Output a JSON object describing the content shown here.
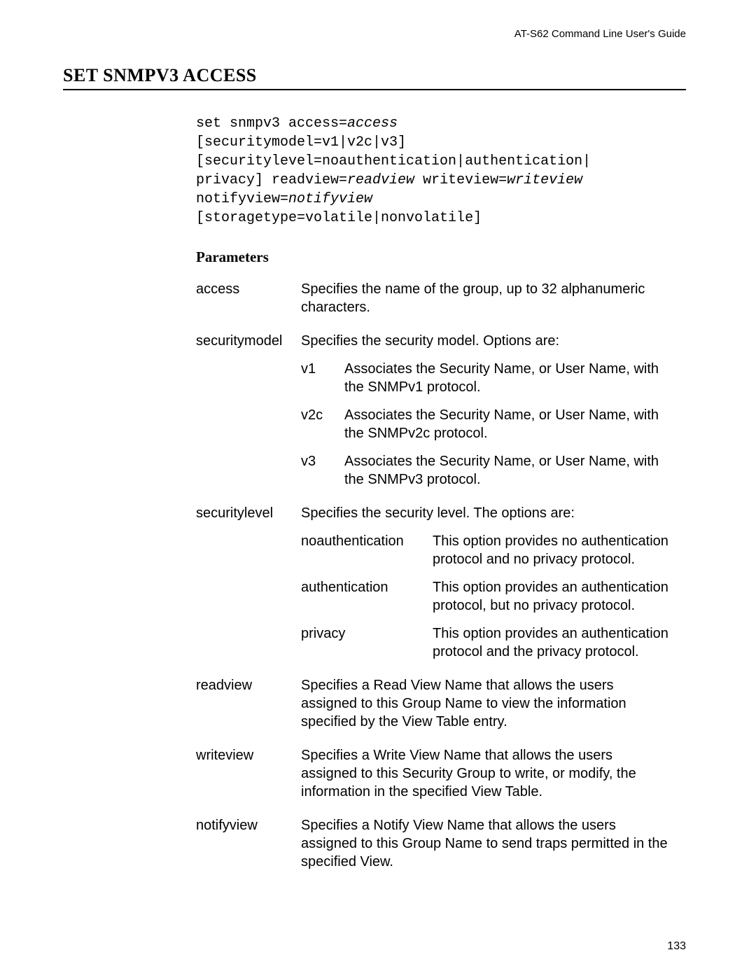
{
  "header": {
    "running": "AT-S62 Command Line User's Guide",
    "section": "SET SNMPV3 ACCESS"
  },
  "syntax": {
    "l1a": "set snmpv3 access=",
    "l1v": "access",
    "l2": "[securitymodel=v1|v2c|v3]",
    "l3": "[securitylevel=noauthentication|authentication|",
    "l4a": "privacy] readview=",
    "l4v1": "readview",
    "l4b": " writeview=",
    "l4v2": "writeview",
    "l5a": "notifyview=",
    "l5v": "notifyview",
    "l6": "[storagetype=volatile|nonvolatile]"
  },
  "labels": {
    "parameters": "Parameters"
  },
  "params": {
    "access": {
      "name": "access",
      "desc": "Specifies the name of the group, up to 32 alphanumeric characters."
    },
    "securitymodel": {
      "name": "securitymodel",
      "desc": "Specifies the security model. Options are:",
      "options": {
        "v1": {
          "key": "v1",
          "desc": "Associates the Security Name, or User Name, with the SNMPv1 protocol."
        },
        "v2c": {
          "key": "v2c",
          "desc": "Associates the Security Name, or User Name, with the SNMPv2c protocol."
        },
        "v3": {
          "key": "v3",
          "desc": "Associates the Security Name, or User Name, with the SNMPv3 protocol."
        }
      }
    },
    "securitylevel": {
      "name": "securitylevel",
      "desc": "Specifies the security level. The options are:",
      "options": {
        "noauth": {
          "key": "noauthentication",
          "desc": "This option provides no authentication protocol and no privacy protocol."
        },
        "auth": {
          "key": "authentication",
          "desc": "This option provides an authentication protocol, but no privacy protocol."
        },
        "priv": {
          "key": "privacy",
          "desc": "This option provides an authentication protocol and the privacy protocol."
        }
      }
    },
    "readview": {
      "name": "readview",
      "desc": "Specifies a Read View Name that allows the users assigned to this Group Name to view the information specified by the View Table entry."
    },
    "writeview": {
      "name": "writeview",
      "desc": "Specifies a Write View Name that allows the users assigned to this Security Group to write, or modify, the information in the specified View Table."
    },
    "notifyview": {
      "name": "notifyview",
      "desc": "Specifies a Notify View Name that allows the users assigned to this Group Name to send traps permitted in the specified View."
    }
  },
  "footer": {
    "page": "133"
  }
}
